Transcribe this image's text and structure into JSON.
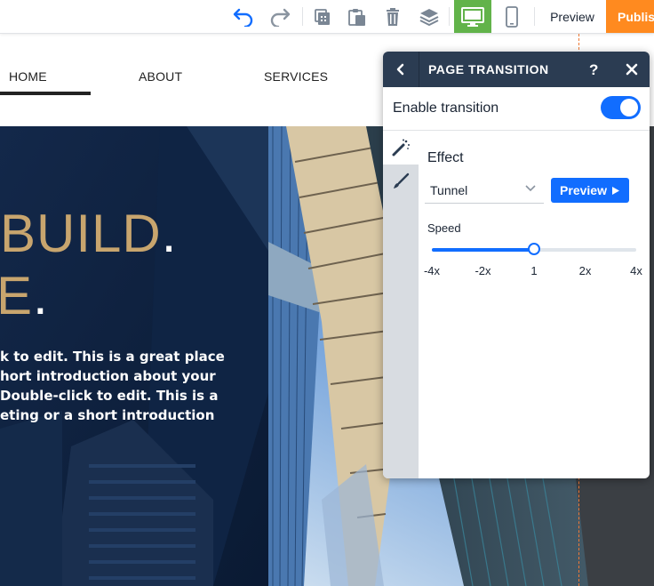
{
  "toolbar": {
    "undo_icon": "undo-icon",
    "redo_icon": "redo-icon",
    "preview_label": "Preview",
    "publish_label": "Publish",
    "accent_publish": "#ff8a1f",
    "accent_desktop": "#62b34a"
  },
  "site": {
    "nav": [
      "HOME",
      "ABOUT",
      "SERVICES"
    ],
    "headline_line1": "BUILD",
    "headline_line2": "E",
    "headline_dot": ".",
    "body_lines": [
      "k to edit. This is a great place",
      "hort introduction about your",
      "Double-click to edit. This is a",
      "eting or a short introduction"
    ]
  },
  "panel": {
    "title": "PAGE TRANSITION",
    "help": "?",
    "enable_label": "Enable transition",
    "enable_on": true,
    "effect_label": "Effect",
    "effect_value": "Tunnel",
    "preview_label": "Preview",
    "speed_label": "Speed",
    "speed_ticks": [
      "-4x",
      "-2x",
      "1",
      "2x",
      "4x"
    ],
    "speed_value": "1",
    "accent": "#116dff",
    "header_color": "#2b3c52"
  }
}
